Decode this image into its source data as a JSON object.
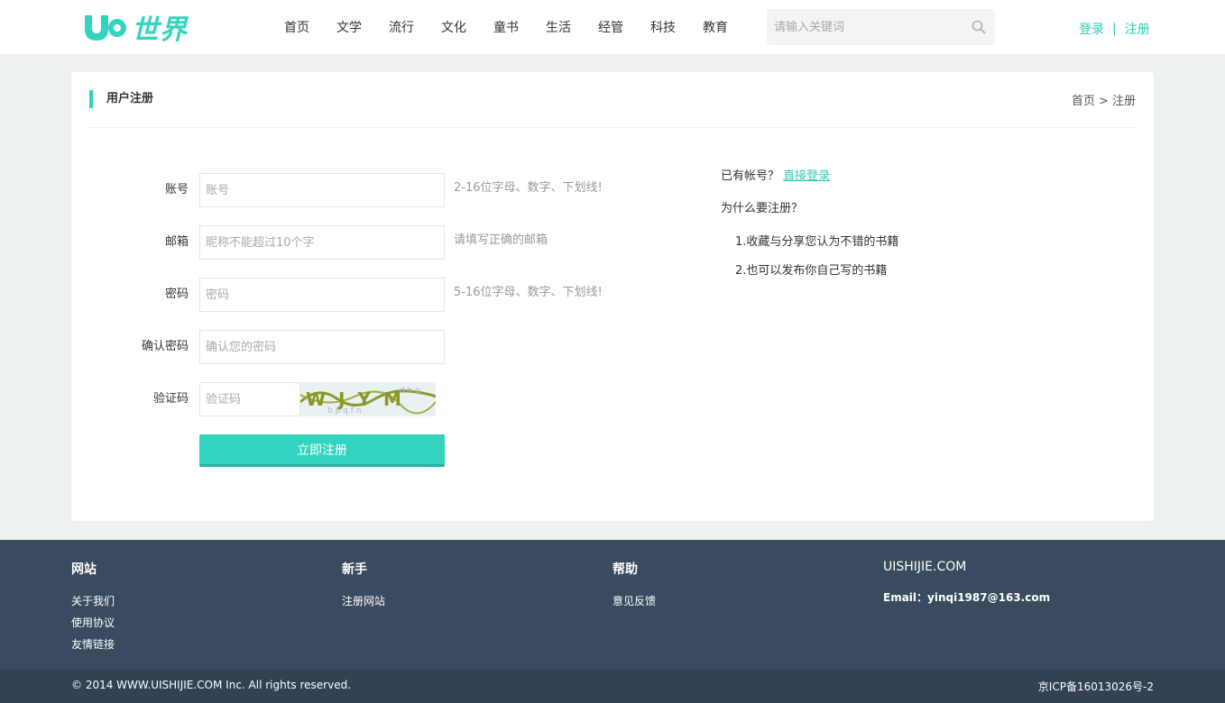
{
  "header": {
    "logo_text": "世界",
    "nav": [
      "首页",
      "文学",
      "流行",
      "文化",
      "童书",
      "生活",
      "经管",
      "科技",
      "教育"
    ],
    "search_placeholder": "请输入关键词",
    "login_label": "登录",
    "separator": "|",
    "register_label": "注册"
  },
  "card": {
    "title": "用户注册",
    "breadcrumb": "首页 > 注册"
  },
  "form": {
    "fields": [
      {
        "label": "账号",
        "placeholder": "账号",
        "hint": "2-16位字母、数字、下划线!"
      },
      {
        "label": "邮箱",
        "placeholder": "昵称不能超过10个字",
        "hint": "请填写正确的邮箱"
      },
      {
        "label": "密码",
        "placeholder": "密码",
        "hint": "5-16位字母、数字、下划线!"
      },
      {
        "label": "确认密码",
        "placeholder": "确认您的密码",
        "hint": ""
      },
      {
        "label": "验证码",
        "placeholder": "验证码",
        "hint": ""
      }
    ],
    "captcha_text": "WJYM",
    "submit_label": "立即注册"
  },
  "side": {
    "have_account": "已有帐号？",
    "login_link": "直接登录",
    "why": "为什么要注册？",
    "reason_1": "1.收藏与分享您认为不错的书籍",
    "reason_2": "2.也可以发布你自己写的书籍"
  },
  "footer": {
    "columns": [
      {
        "title": "网站",
        "links": [
          "关于我们",
          "使用协议",
          "友情链接"
        ]
      },
      {
        "title": "新手",
        "links": [
          "注册网站"
        ]
      },
      {
        "title": "帮助",
        "links": [
          "意见反馈"
        ]
      },
      {
        "title": "UISHIJIE.COM",
        "links": [
          "Email：yinqi1987@163.com"
        ]
      }
    ],
    "copyright": "© 2014 WWW.UISHIJIE.COM Inc. All rights reserved.",
    "icp": "京ICP备16013026号-2"
  },
  "colors": {
    "accent": "#33d4bf",
    "footer_bg": "#3a4b5f",
    "footer_bottom_bg": "#324154",
    "page_bg": "#eef1f1"
  }
}
